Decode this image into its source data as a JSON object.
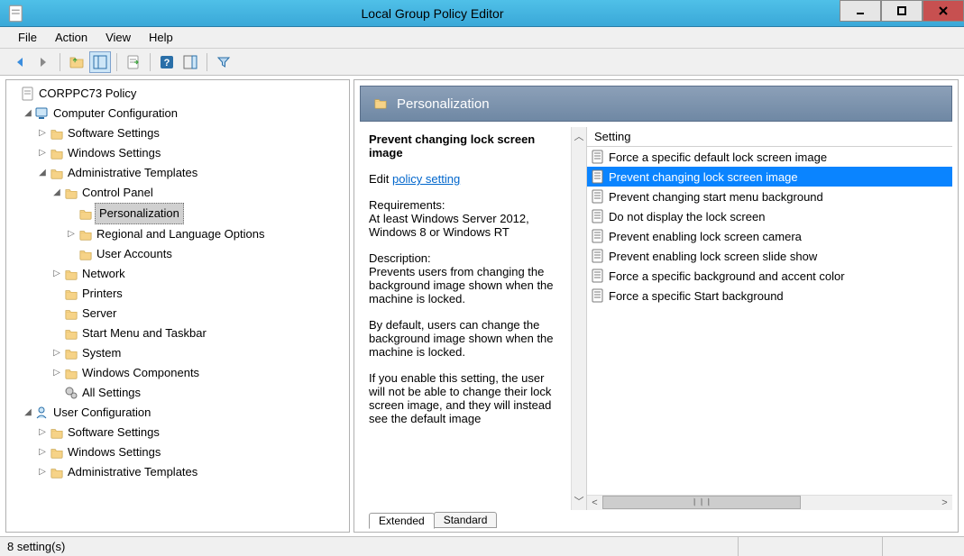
{
  "window": {
    "title": "Local Group Policy Editor"
  },
  "menu": {
    "file": "File",
    "action": "Action",
    "view": "View",
    "help": "Help"
  },
  "tree": {
    "root": "CORPPC73 Policy",
    "cc": "Computer Configuration",
    "cc_soft": "Software Settings",
    "cc_win": "Windows Settings",
    "cc_adm": "Administrative Templates",
    "cp": "Control Panel",
    "cp_pers": "Personalization",
    "cp_reg": "Regional and Language Options",
    "cp_ua": "User Accounts",
    "net": "Network",
    "prn": "Printers",
    "srv": "Server",
    "smt": "Start Menu and Taskbar",
    "sys": "System",
    "wc": "Windows Components",
    "alls": "All Settings",
    "uc": "User Configuration",
    "uc_soft": "Software Settings",
    "uc_win": "Windows Settings",
    "uc_adm": "Administrative Templates"
  },
  "header": {
    "title": "Personalization"
  },
  "policy": {
    "name": "Prevent changing lock screen image",
    "edit_prefix": "Edit",
    "edit_link": "policy setting",
    "req_h": "Requirements:",
    "req_body": "At least Windows Server 2012, Windows 8 or Windows RT",
    "desc_h": "Description:",
    "desc_p1": "Prevents users from changing the background image shown when the machine is locked.",
    "desc_p2": "By default, users can change the background image shown when the machine is locked.",
    "desc_p3": "If you enable this setting, the user will not be able to change their lock screen image, and they will instead see the default image"
  },
  "list": {
    "col": "Setting",
    "items": [
      "Force a specific default lock screen image",
      "Prevent changing lock screen image",
      "Prevent changing start menu background",
      "Do not display the lock screen",
      "Prevent enabling lock screen camera",
      "Prevent enabling lock screen slide show",
      "Force a specific background and accent color",
      "Force a specific Start background"
    ],
    "selected_index": 1
  },
  "tabs": {
    "extended": "Extended",
    "standard": "Standard"
  },
  "status": {
    "count": "8 setting(s)"
  }
}
